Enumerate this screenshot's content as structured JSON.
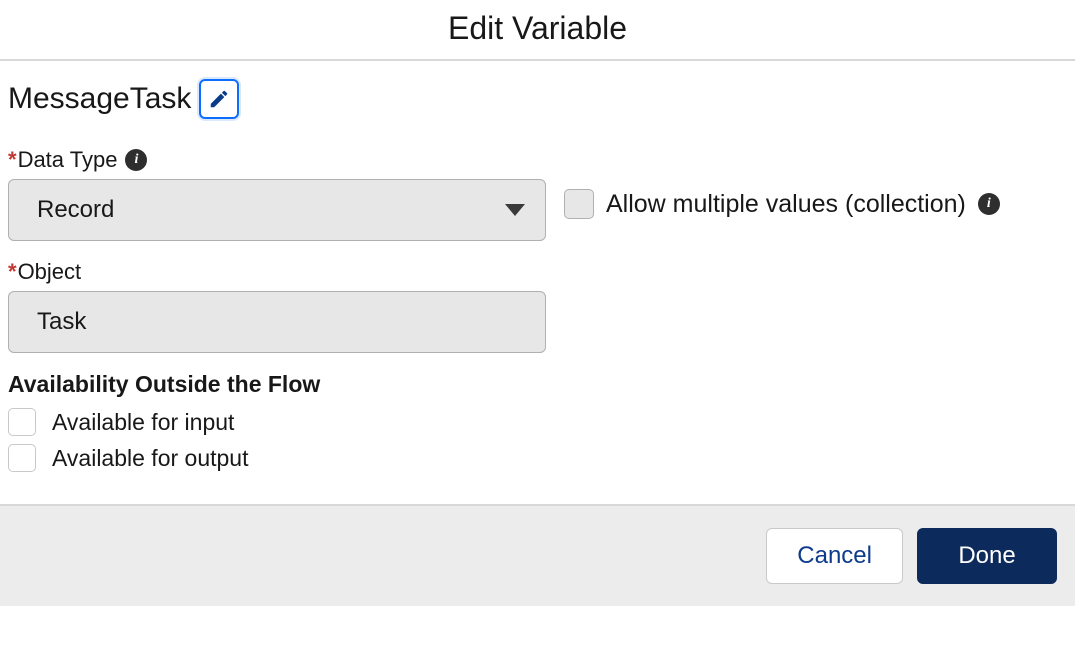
{
  "header": {
    "title": "Edit Variable"
  },
  "variable": {
    "name": "MessageTask"
  },
  "fields": {
    "dataType": {
      "label": "Data Type",
      "value": "Record",
      "required": true
    },
    "allowMultiple": {
      "label": "Allow multiple values (collection)",
      "checked": false
    },
    "object": {
      "label": "Object",
      "value": "Task",
      "required": true
    }
  },
  "availability": {
    "heading": "Availability Outside the Flow",
    "input": {
      "label": "Available for input",
      "checked": false
    },
    "output": {
      "label": "Available for output",
      "checked": false
    }
  },
  "footer": {
    "cancel": "Cancel",
    "done": "Done"
  }
}
